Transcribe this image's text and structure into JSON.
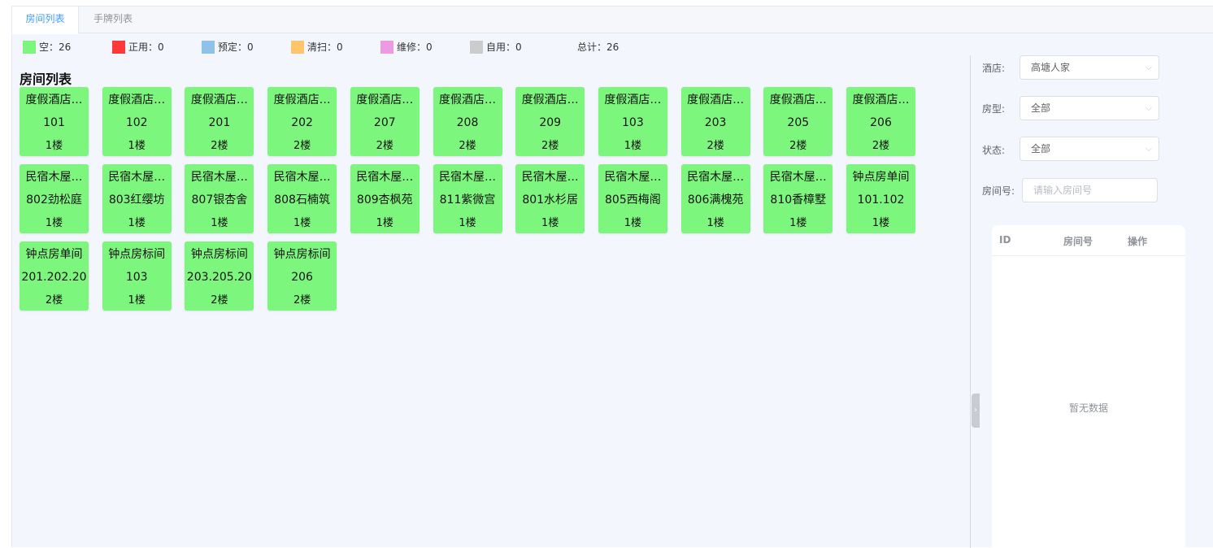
{
  "tabs": [
    {
      "label": "房间列表",
      "active": true
    },
    {
      "label": "手牌列表",
      "active": false
    }
  ],
  "legend": [
    {
      "label": "空：26",
      "color": "#7cf67c"
    },
    {
      "label": "正用：0",
      "color": "#ff3838"
    },
    {
      "label": "预定：0",
      "color": "#8ec2ea"
    },
    {
      "label": "清扫：0",
      "color": "#ffc56b"
    },
    {
      "label": "维修：0",
      "color": "#ea9be1"
    },
    {
      "label": "自用：0",
      "color": "#cccccc"
    }
  ],
  "legend_total": "总计：26",
  "section_title": "房间列表",
  "room_color": "#7cf67c",
  "rooms": [
    {
      "name": "度假酒店…",
      "number": "101",
      "floor": "1楼"
    },
    {
      "name": "度假酒店…",
      "number": "102",
      "floor": "1楼"
    },
    {
      "name": "度假酒店…",
      "number": "201",
      "floor": "2楼"
    },
    {
      "name": "度假酒店…",
      "number": "202",
      "floor": "2楼"
    },
    {
      "name": "度假酒店…",
      "number": "207",
      "floor": "2楼"
    },
    {
      "name": "度假酒店…",
      "number": "208",
      "floor": "2楼"
    },
    {
      "name": "度假酒店…",
      "number": "209",
      "floor": "2楼"
    },
    {
      "name": "度假酒店…",
      "number": "103",
      "floor": "1楼"
    },
    {
      "name": "度假酒店…",
      "number": "203",
      "floor": "2楼"
    },
    {
      "name": "度假酒店…",
      "number": "205",
      "floor": "2楼"
    },
    {
      "name": "度假酒店…",
      "number": "206",
      "floor": "2楼"
    },
    {
      "name": "民宿木屋…",
      "number": "802劲松庭",
      "floor": "1楼"
    },
    {
      "name": "民宿木屋…",
      "number": "803红缨坊",
      "floor": "1楼"
    },
    {
      "name": "民宿木屋…",
      "number": "807银杏舍",
      "floor": "1楼"
    },
    {
      "name": "民宿木屋…",
      "number": "808石楠筑",
      "floor": "1楼"
    },
    {
      "name": "民宿木屋…",
      "number": "809杏枫苑",
      "floor": "1楼"
    },
    {
      "name": "民宿木屋…",
      "number": "811紫微宫",
      "floor": "1楼"
    },
    {
      "name": "民宿木屋…",
      "number": "801水杉居",
      "floor": "1楼"
    },
    {
      "name": "民宿木屋…",
      "number": "805西梅阁",
      "floor": "1楼"
    },
    {
      "name": "民宿木屋…",
      "number": "806满槐苑",
      "floor": "1楼"
    },
    {
      "name": "民宿木屋…",
      "number": "810香樟墅",
      "floor": "1楼"
    },
    {
      "name": "钟点房单间",
      "number": "101.102",
      "floor": "1楼"
    },
    {
      "name": "钟点房单间",
      "number": "201.202.20",
      "floor": "2楼"
    },
    {
      "name": "钟点房标间",
      "number": "103",
      "floor": "1楼"
    },
    {
      "name": "钟点房标间",
      "number": "203.205.20",
      "floor": "2楼"
    },
    {
      "name": "钟点房标间",
      "number": "206",
      "floor": "2楼"
    }
  ],
  "filters": {
    "hotel_label": "酒店:",
    "hotel_value": "高塘人家",
    "room_type_label": "房型:",
    "room_type_value": "全部",
    "status_label": "状态:",
    "status_value": "全部",
    "room_no_label": "房间号:",
    "room_no_placeholder": "请输入房间号"
  },
  "table": {
    "col_id": "ID",
    "col_room_no": "房间号",
    "col_action": "操作",
    "empty_text": "暂无数据"
  },
  "icons": {
    "select_arrow": "chevron-down-icon",
    "collapse_handle": "chevron-right-icon"
  }
}
